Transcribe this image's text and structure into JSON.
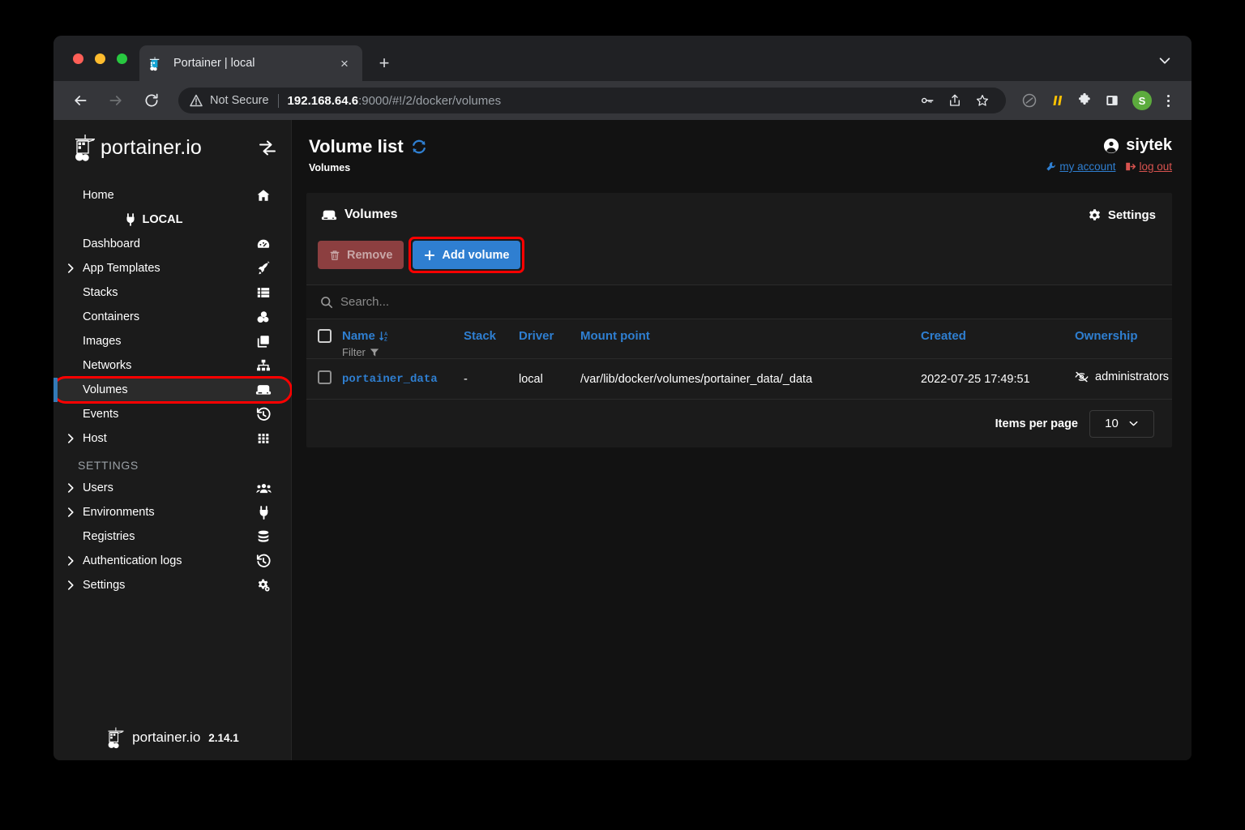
{
  "browser": {
    "tab": {
      "title": "Portainer | local",
      "favicon": "portainer-favicon",
      "close_label": "×"
    },
    "newtab_label": "+",
    "nav": {
      "back": "←",
      "forward": "→",
      "reload": "⟳"
    },
    "omnibox": {
      "security_label": "Not Secure",
      "url_host": "192.168.64.6",
      "url_path": ":9000/#!/2/docker/volumes"
    },
    "profile_initial": "S"
  },
  "sidebar": {
    "brand": "portainer.io",
    "items": [
      {
        "label": "Home",
        "icon": "home-icon",
        "caret": false,
        "active": false
      },
      {
        "label": "LOCAL",
        "icon": "plug-icon",
        "group": true
      },
      {
        "label": "Dashboard",
        "icon": "dashboard-icon",
        "caret": false,
        "active": false
      },
      {
        "label": "App Templates",
        "icon": "rocket-icon",
        "caret": true,
        "active": false
      },
      {
        "label": "Stacks",
        "icon": "stacks-icon",
        "caret": false,
        "active": false
      },
      {
        "label": "Containers",
        "icon": "containers-icon",
        "caret": false,
        "active": false
      },
      {
        "label": "Images",
        "icon": "images-icon",
        "caret": false,
        "active": false
      },
      {
        "label": "Networks",
        "icon": "networks-icon",
        "caret": false,
        "active": false
      },
      {
        "label": "Volumes",
        "icon": "volumes-icon",
        "caret": false,
        "active": true,
        "highlighted": true
      },
      {
        "label": "Events",
        "icon": "events-icon",
        "caret": false,
        "active": false
      },
      {
        "label": "Host",
        "icon": "host-icon",
        "caret": true,
        "active": false
      }
    ],
    "section_label": "SETTINGS",
    "settings_items": [
      {
        "label": "Users",
        "icon": "users-icon",
        "caret": true
      },
      {
        "label": "Environments",
        "icon": "plug-icon",
        "caret": true
      },
      {
        "label": "Registries",
        "icon": "registries-icon",
        "caret": false
      },
      {
        "label": "Authentication logs",
        "icon": "history-icon",
        "caret": true
      },
      {
        "label": "Settings",
        "icon": "gears-icon",
        "caret": true
      }
    ],
    "footer": {
      "brand": "portainer.io",
      "version": "2.14.1"
    }
  },
  "page_header": {
    "title": "Volume list",
    "refresh_icon": "refresh-icon",
    "breadcrumb": "Volumes",
    "username": "siytek",
    "my_account_label": "my account",
    "logout_label": "log out"
  },
  "panel": {
    "title": "Volumes",
    "title_icon": "volumes-icon",
    "settings_label": "Settings",
    "remove_label": "Remove",
    "add_label": "Add volume",
    "search_placeholder": "Search...",
    "search_value": "",
    "columns": {
      "name": "Name",
      "filter": "Filter",
      "stack": "Stack",
      "driver": "Driver",
      "mount_point": "Mount point",
      "created": "Created",
      "ownership": "Ownership"
    },
    "rows": [
      {
        "name": "portainer_data",
        "stack": "-",
        "driver": "local",
        "mount_point": "/var/lib/docker/volumes/portainer_data/_data",
        "created": "2022-07-25 17:49:51",
        "ownership": "administrators",
        "ownership_icon": "eye-slash-icon"
      }
    ],
    "items_per_page_label": "Items per page",
    "items_per_page_value": "10"
  },
  "colors": {
    "accent_blue": "#2f7fd1",
    "danger_red": "#d9534f",
    "highlight_red": "#ff0000",
    "sidebar_bg": "#1b1b1b",
    "page_bg": "#121212",
    "active_bar": "#337ab7"
  }
}
